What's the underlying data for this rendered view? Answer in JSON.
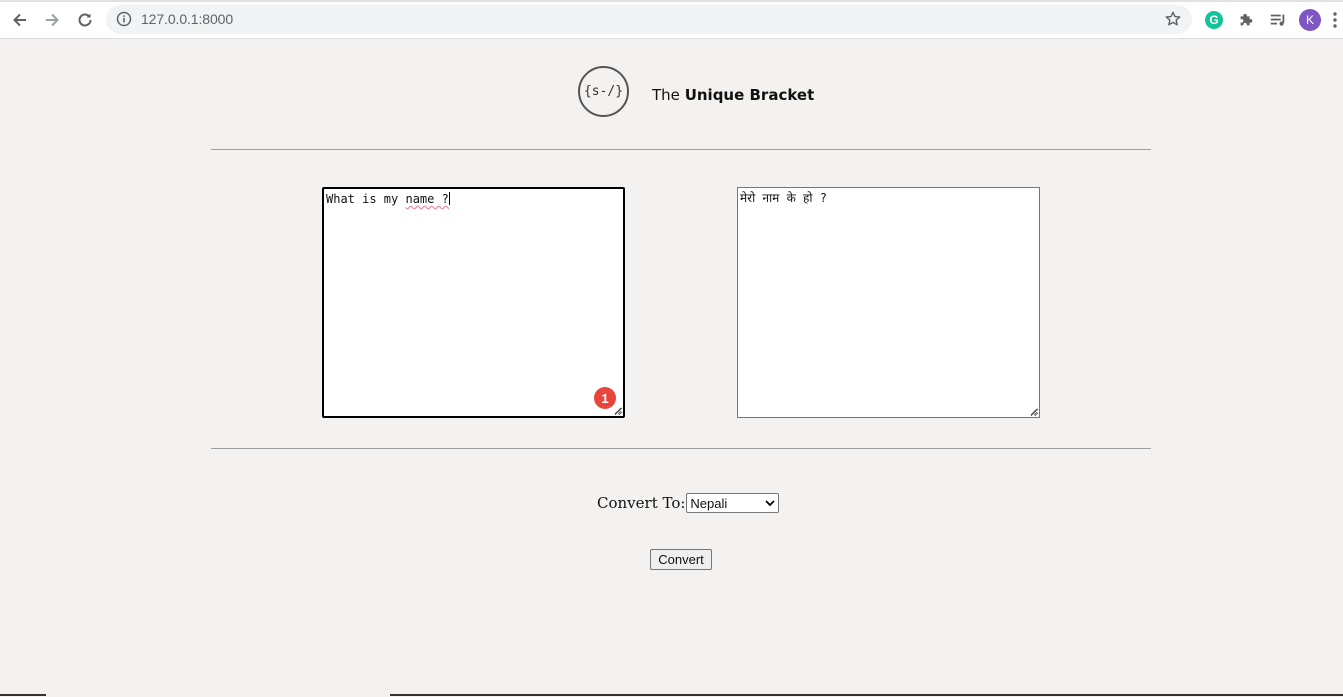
{
  "browser": {
    "url": "127.0.0.1:8000",
    "profile_initial": "K",
    "grammarly_letter": "G",
    "icons": [
      "back-arrow-icon",
      "forward-arrow-icon",
      "reload-icon",
      "info-icon",
      "star-icon",
      "grammarly-icon",
      "puzzle-icon",
      "reading-list-icon",
      "kebab-menu-icon"
    ]
  },
  "header": {
    "logo_text": "{s-/}",
    "brand_prefix": "The",
    "brand_bold": "Unique Bracket"
  },
  "translator": {
    "input_before": "What is my ",
    "input_misspelled": "name ?",
    "output_text": "मेरो नाम के हो ?",
    "grammarly_count": "1"
  },
  "controls": {
    "convert_to_label": "Convert To:",
    "language_selected": "Nepali",
    "convert_button": "Convert"
  },
  "colors": {
    "page_bg": "#f3f2f1",
    "grammarly_green": "#15c39a",
    "badge_red": "#e8463b",
    "avatar_purple": "#7e57c2"
  }
}
